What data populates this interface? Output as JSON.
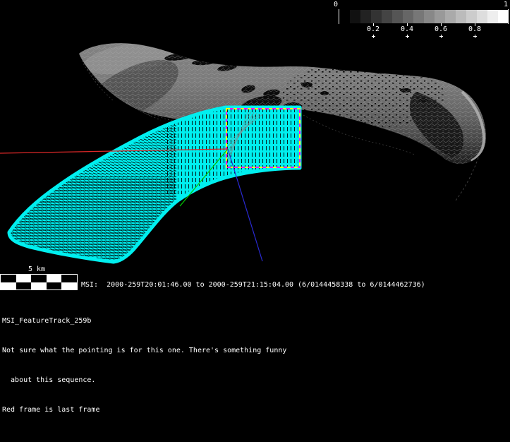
{
  "colorbar": {
    "min_label": "0",
    "max_label": "1",
    "ticks": [
      "0.2",
      "0.4",
      "0.6",
      "0.8"
    ],
    "tick_fractions": [
      0.2,
      0.4,
      0.6,
      0.8
    ],
    "steps": 16,
    "start_color": "#000000",
    "end_color": "#ffffff"
  },
  "scale_bar": {
    "label": "5 km",
    "columns": 5,
    "rows": 2
  },
  "status_line": "MSI:  2000-259T20:01:46.00 to 2000-259T21:15:04.00 (6/0144458338 to 6/0144462736)",
  "notes": {
    "sequence_id": "MSI_FeatureTrack_259b",
    "line1": "Not sure what the pointing is for this one. There's something funny",
    "line2": "  about this sequence.",
    "line3": "Red frame is last frame"
  },
  "scene": {
    "swath_color": "#00efef",
    "last_frame_border_colors": [
      "#ffff00",
      "#ff00ff"
    ],
    "pointing_line_colors": {
      "red": "#dd2828",
      "green": "#00cc00",
      "blue": "#2a2ad4"
    }
  }
}
